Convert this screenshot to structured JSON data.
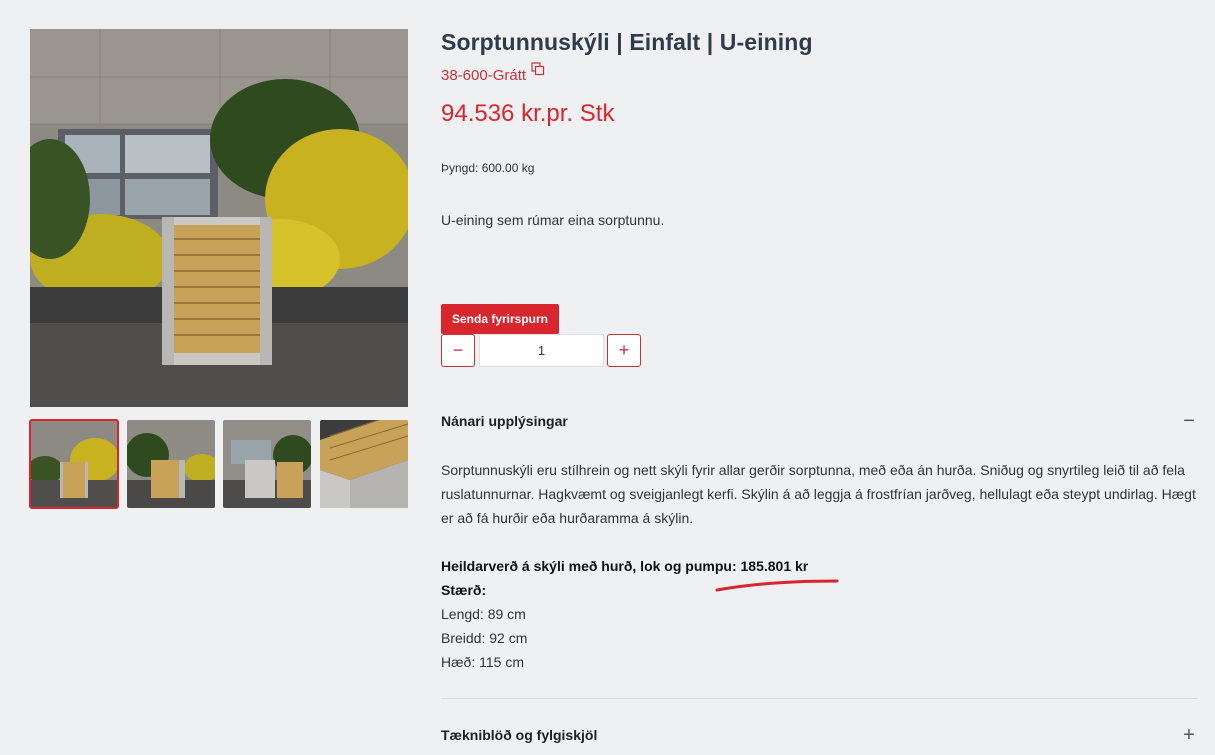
{
  "product": {
    "title": "Sorptunnuskýli | Einfalt | U-eining",
    "sku": "38-600-Grátt",
    "price": "94.536 kr.pr. Stk",
    "weight": "Þyngd: 600.00 kg",
    "short_description": "U-eining sem rúmar eina sorptunnu."
  },
  "actions": {
    "inquiry_label": "Senda fyrirspurn",
    "minus_label": "−",
    "plus_label": "+",
    "quantity": "1"
  },
  "details": {
    "heading": "Nánari upplýsingar",
    "toggle": "−",
    "description": "Sorptunnuskýli eru stílhrein og nett skýli fyrir allar gerðir sorptunna, með eða án hurða. Sniðug og snyrtileg leið til að fela ruslatunnurnar. Hagkvæmt og sveigjanlegt kerfi. Skýlin á að leggja á frostfrían jarðveg, hellulagt eða steypt undirlag. Hægt er að fá hurðir eða hurðaramma á skýlin.",
    "total_price_line": "Heildarverð á skýli með hurð, lok og pumpu: 185.801 kr",
    "size_heading": "Stærð:",
    "length": "Lengd: 89 cm",
    "width": "Breidd: 92 cm",
    "height": "Hæð: 115 cm"
  },
  "tech": {
    "heading": "Tækniblöð og fylgiskjöl",
    "toggle": "+"
  },
  "gallery": {
    "selected_index": 0,
    "thumbnail_count": 4
  },
  "colors": {
    "accent": "#d8262e",
    "title": "#2f3a4a",
    "background": "#eff0f2"
  }
}
